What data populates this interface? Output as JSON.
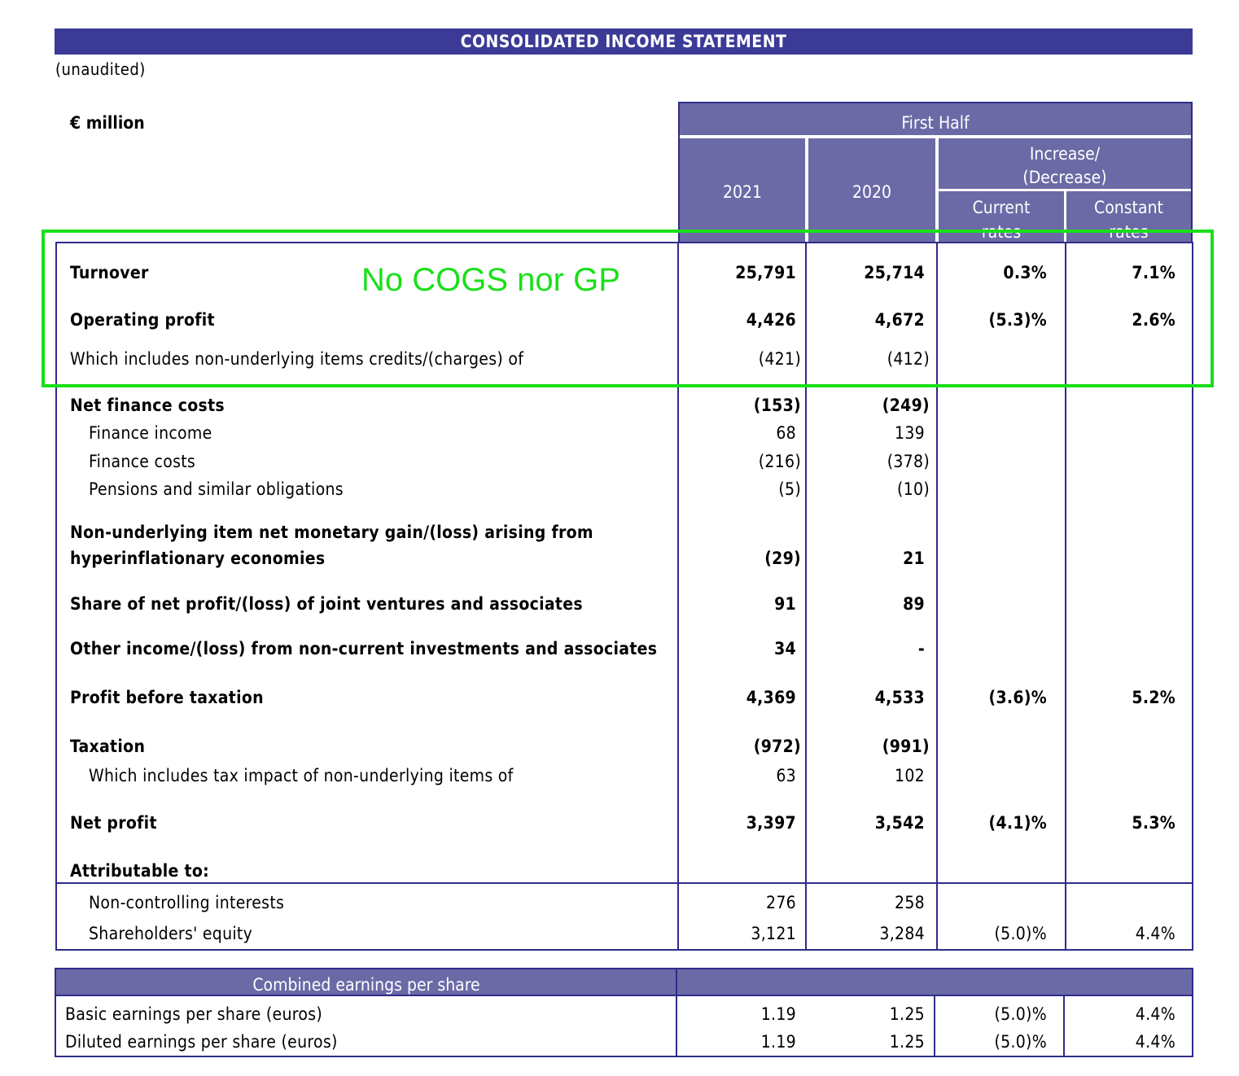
{
  "statement": {
    "title": "CONSOLIDATED INCOME STATEMENT",
    "subtitle": "(unaudited)",
    "unit": "€ million"
  },
  "header": {
    "period": "First Half",
    "y2021": "2021",
    "y2020": "2020",
    "change_line1": "Increase/",
    "change_line2": "(Decrease)",
    "current_l1": "Current",
    "current_l2": "rates",
    "constant_l1": "Constant",
    "constant_l2": "rates"
  },
  "annotation": {
    "text": "No COGS nor GP",
    "color": "#19e019"
  },
  "rows": {
    "turnover": {
      "label": "Turnover",
      "v2021": "25,791",
      "v2020": "25,714",
      "current": "0.3%",
      "constant": "7.1%"
    },
    "operating_profit": {
      "label": "Operating profit",
      "v2021": "4,426",
      "v2020": "4,672",
      "current": "(5.3)%",
      "constant": "2.6%"
    },
    "non_underlying": {
      "label": "Which includes  non-underlying  items credits/(charges)  of",
      "v2021": "(421)",
      "v2020": "(412)"
    },
    "net_finance": {
      "label": "Net finance costs",
      "v2021": "(153)",
      "v2020": "(249)"
    },
    "finance_income": {
      "label": "Finance income",
      "v2021": "68",
      "v2020": "139"
    },
    "finance_costs": {
      "label": "Finance costs",
      "v2021": "(216)",
      "v2020": "(378)"
    },
    "pensions": {
      "label": "Pensions and similar obligations",
      "v2021": "(5)",
      "v2020": "(10)"
    },
    "hyperinfl": {
      "label_l1": "Non-underlying  item net monetary gain/(loss) arising from",
      "label_l2": "hyperinflationary  economies",
      "v2021": "(29)",
      "v2020": "21"
    },
    "share_jv": {
      "label": "Share of net profit/(loss) of joint ventures and associates",
      "v2021": "91",
      "v2020": "89"
    },
    "other_income": {
      "label": "Other income/(loss) from non-current  investments and associates",
      "v2021": "34",
      "v2020": "-"
    },
    "pbt": {
      "label": "Profit before taxation",
      "v2021": "4,369",
      "v2020": "4,533",
      "current": "(3.6)%",
      "constant": "5.2%"
    },
    "taxation": {
      "label": "Taxation",
      "v2021": "(972)",
      "v2020": "(991)"
    },
    "tax_nonund": {
      "label": "Which includes  tax impact of non-underlying items of",
      "v2021": "63",
      "v2020": "102"
    },
    "net_profit": {
      "label": "Net profit",
      "v2021": "3,397",
      "v2020": "3,542",
      "current": "(4.1)%",
      "constant": "5.3%"
    },
    "attributable": {
      "label": "Attributable to:"
    },
    "nci": {
      "label": "Non-controlling  interests",
      "v2021": "276",
      "v2020": "258"
    },
    "sh_equity": {
      "label": "Shareholders'  equity",
      "v2021": "3,121",
      "v2020": "3,284",
      "current": "(5.0)%",
      "constant": "4.4%"
    }
  },
  "eps": {
    "title": "Combined earnings  per share",
    "basic": {
      "label": "Basic earnings per share (euros)",
      "v2021": "1.19",
      "v2020": "1.25",
      "current": "(5.0)%",
      "constant": "4.4%"
    },
    "diluted": {
      "label": "Diluted earnings per share (euros)",
      "v2021": "1.19",
      "v2020": "1.25",
      "current": "(5.0)%",
      "constant": "4.4%"
    }
  }
}
